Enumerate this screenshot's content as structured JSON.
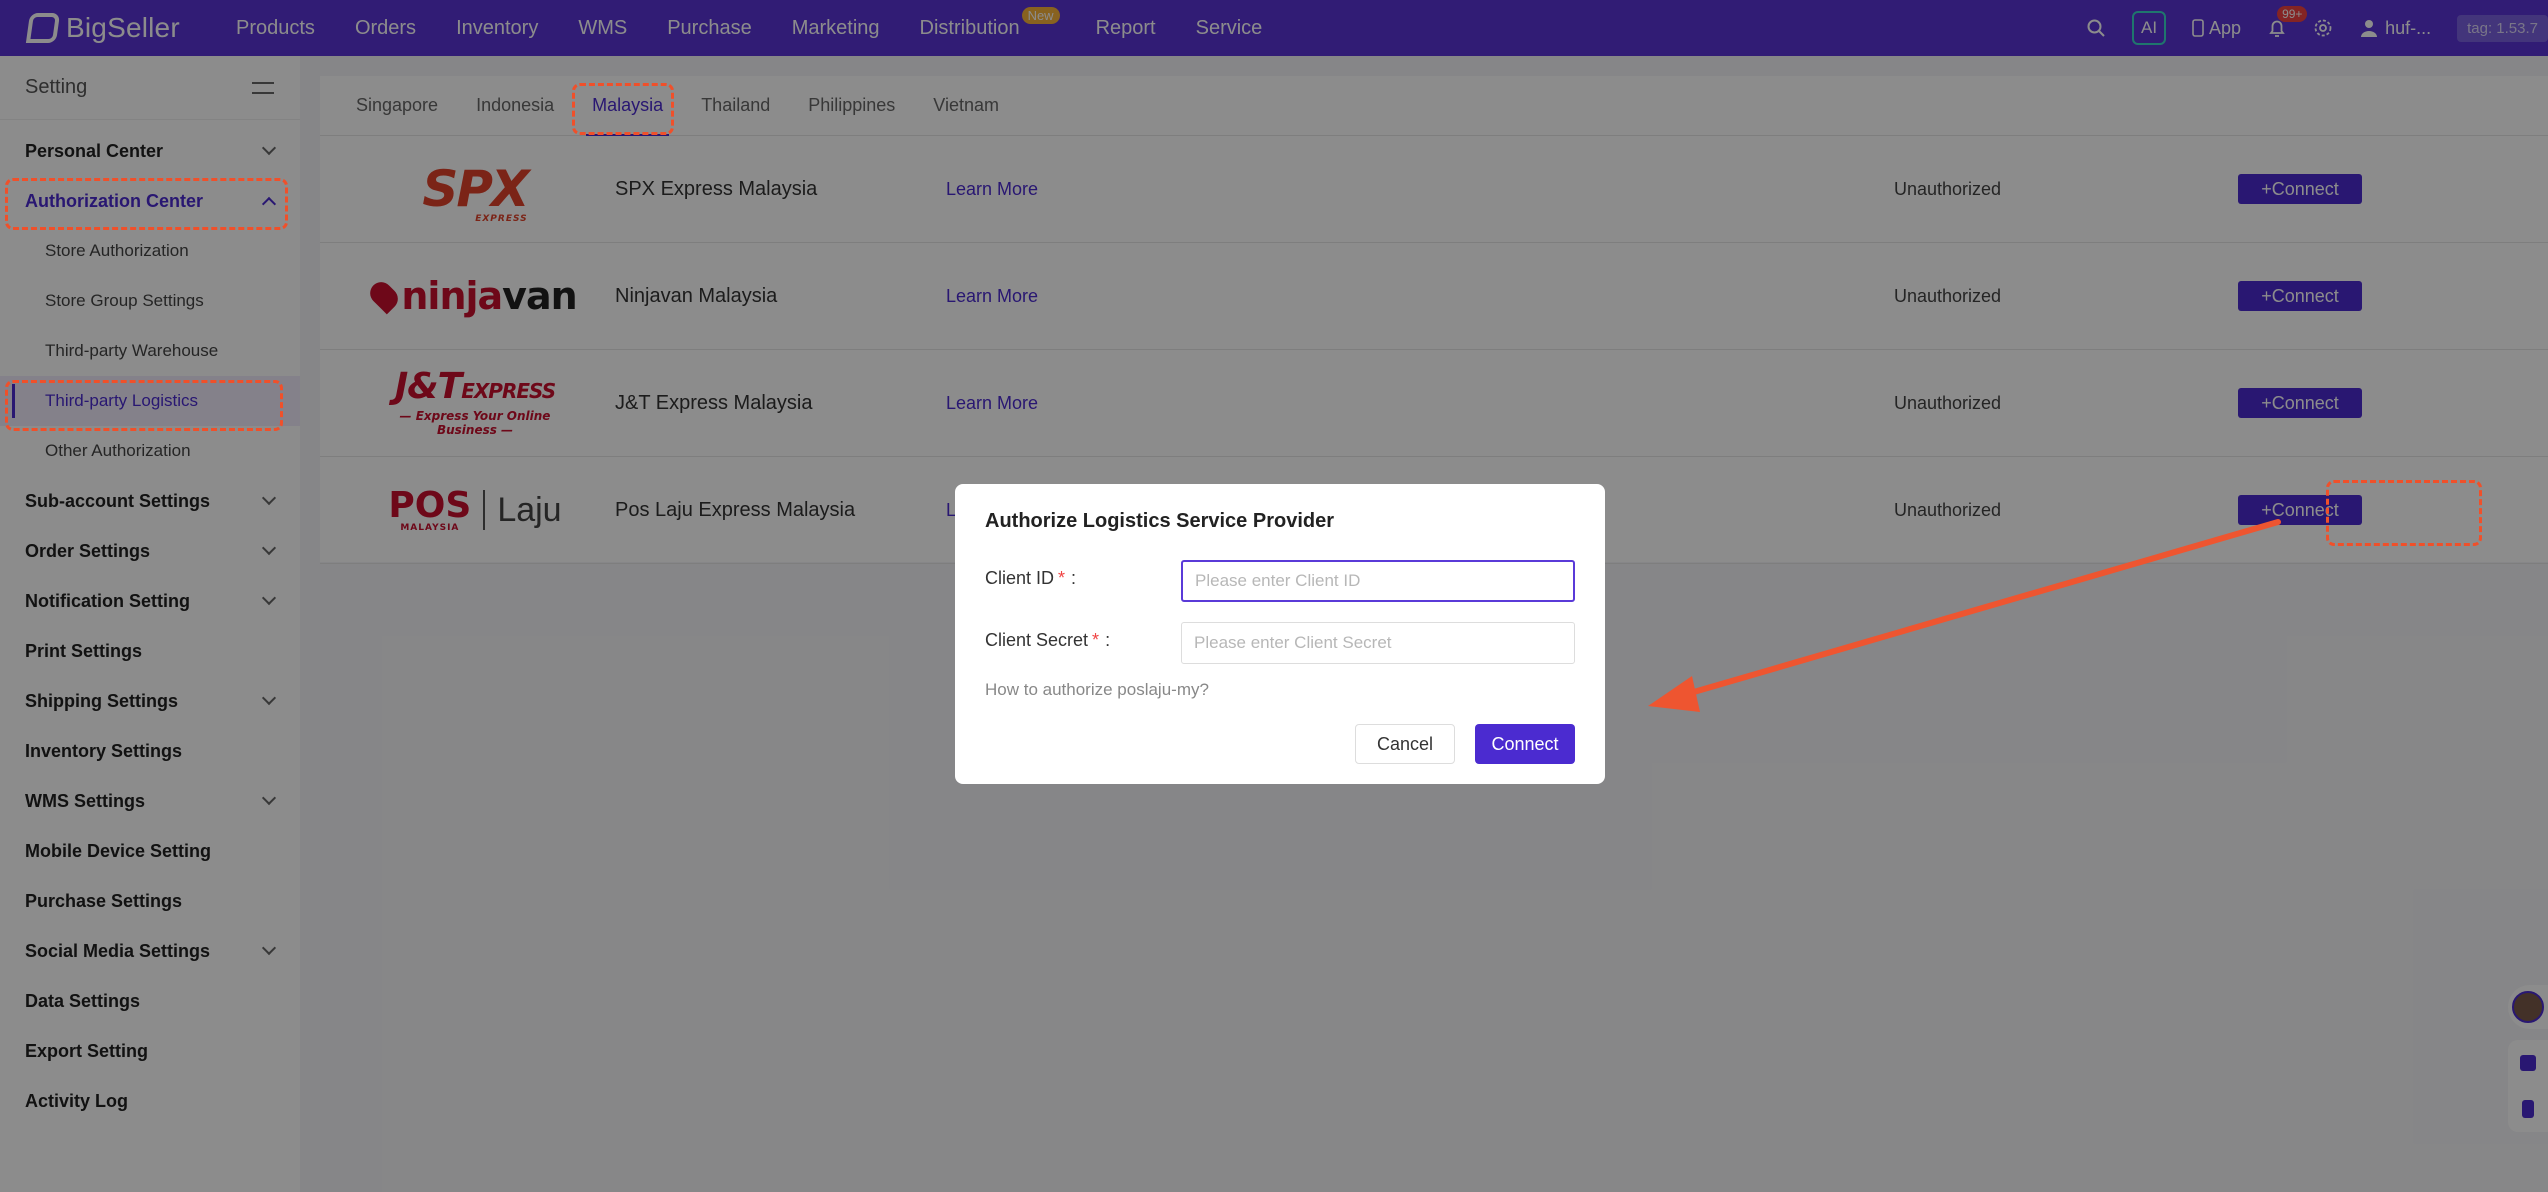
{
  "app": {
    "logo_text": "BigSeller"
  },
  "topnav": {
    "items": [
      "Products",
      "Orders",
      "Inventory",
      "WMS",
      "Purchase",
      "Marketing",
      "Distribution",
      "Report",
      "Service"
    ],
    "distribution_badge": "New",
    "ai_label": "AI",
    "app_label": "App",
    "notification_badge": "99+",
    "user_name": "huf-...",
    "tag": "tag: 1.53.7"
  },
  "sidebar": {
    "title": "Setting",
    "items": [
      {
        "label": "Personal Center",
        "type": "group"
      },
      {
        "label": "Authorization Center",
        "type": "group-open"
      },
      {
        "label": "Store Authorization",
        "type": "sub"
      },
      {
        "label": "Store Group Settings",
        "type": "sub"
      },
      {
        "label": "Third-party Warehouse",
        "type": "sub"
      },
      {
        "label": "Third-party Logistics",
        "type": "sub-active"
      },
      {
        "label": "Other Authorization",
        "type": "sub"
      },
      {
        "label": "Sub-account Settings",
        "type": "group"
      },
      {
        "label": "Order Settings",
        "type": "group"
      },
      {
        "label": "Notification Setting",
        "type": "group"
      },
      {
        "label": "Print Settings",
        "type": "leaf"
      },
      {
        "label": "Shipping Settings",
        "type": "group"
      },
      {
        "label": "Inventory Settings",
        "type": "leaf"
      },
      {
        "label": "WMS Settings",
        "type": "group"
      },
      {
        "label": "Mobile Device Setting",
        "type": "leaf"
      },
      {
        "label": "Purchase Settings",
        "type": "leaf"
      },
      {
        "label": "Social Media Settings",
        "type": "group"
      },
      {
        "label": "Data Settings",
        "type": "leaf"
      },
      {
        "label": "Export Setting",
        "type": "leaf"
      },
      {
        "label": "Activity Log",
        "type": "leaf"
      }
    ]
  },
  "tabs": {
    "items": [
      "Singapore",
      "Indonesia",
      "Malaysia",
      "Thailand",
      "Philippines",
      "Vietnam"
    ],
    "active": "Malaysia"
  },
  "providers": [
    {
      "name": "SPX Express Malaysia",
      "learn_more": "Learn More",
      "status": "Unauthorized",
      "button": "+Connect",
      "logo": "spx-logo"
    },
    {
      "name": "Ninjavan Malaysia",
      "learn_more": "Learn More",
      "status": "Unauthorized",
      "button": "+Connect",
      "logo": "ninjavan-logo"
    },
    {
      "name": "J&T Express Malaysia",
      "learn_more": "Learn More",
      "status": "Unauthorized",
      "button": "+Connect",
      "logo": "jt-logo"
    },
    {
      "name": "Pos Laju Express Malaysia",
      "learn_more": "L",
      "status": "Unauthorized",
      "button": "+Connect",
      "logo": "poslaju-logo"
    }
  ],
  "logos": {
    "spx": "SPX",
    "spx_sub": "EXPRESS",
    "ninjavan_a": "ninja",
    "ninjavan_b": "van",
    "jt_main": "J&T",
    "jt_express": "EXPRESS",
    "jt_sub": "— Express Your Online Business —",
    "pos_mark": "POS",
    "pos_sub": "MALAYSIA",
    "pos_laju": "Laju"
  },
  "modal": {
    "title": "Authorize Logistics Service Provider",
    "client_id_label": "Client ID",
    "client_id_placeholder": "Please enter Client ID",
    "client_secret_label": "Client Secret",
    "client_secret_placeholder": "Please enter Client Secret",
    "required_mark": "*",
    "colon": ":",
    "help_link": "How to authorize poslaju-my?",
    "cancel": "Cancel",
    "connect": "Connect"
  },
  "colors": {
    "brand": "#5a33d6",
    "accent": "#4b2bd0",
    "highlight": "#f0502a"
  }
}
